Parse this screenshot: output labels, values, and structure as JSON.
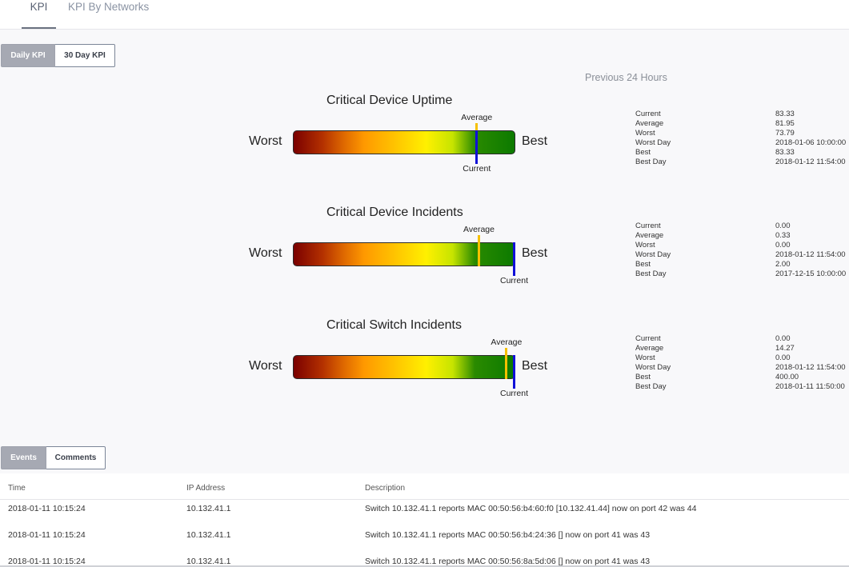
{
  "tabs": [
    {
      "label": "KPI",
      "active": true
    },
    {
      "label": "KPI By Networks",
      "active": false
    }
  ],
  "kpi_toggle": {
    "daily_label": "Daily KPI",
    "thirty_label": "30 Day KPI",
    "active": "daily"
  },
  "period_label": "Previous 24 Hours",
  "colors": {
    "average_marker": "#f5c000",
    "current_marker": "#1010d8",
    "gradient_worst": "#7a0000",
    "gradient_best": "#0c7a00"
  },
  "scale_labels": {
    "worst": "Worst",
    "best": "Best",
    "average": "Average",
    "current": "Current"
  },
  "kpis": [
    {
      "title": "Critical Device Uptime",
      "average_fraction": 0.83,
      "current_fraction": 0.83,
      "stats": [
        {
          "label": "Current",
          "value": "83.33"
        },
        {
          "label": "Average",
          "value": "81.95"
        },
        {
          "label": "Worst",
          "value": "73.79"
        },
        {
          "label": "Worst Day",
          "value": "2018-01-06 10:00:00"
        },
        {
          "label": "Best",
          "value": "83.33"
        },
        {
          "label": "Best Day",
          "value": "2018-01-12 11:54:00"
        }
      ]
    },
    {
      "title": "Critical Device Incidents",
      "average_fraction": 0.84,
      "current_fraction": 1.0,
      "stats": [
        {
          "label": "Current",
          "value": "0.00"
        },
        {
          "label": "Average",
          "value": "0.33"
        },
        {
          "label": "Worst",
          "value": "0.00"
        },
        {
          "label": "Worst Day",
          "value": "2018-01-12 11:54:00"
        },
        {
          "label": "Best",
          "value": "2.00"
        },
        {
          "label": "Best Day",
          "value": "2017-12-15 10:00:00"
        }
      ]
    },
    {
      "title": "Critical Switch Incidents",
      "average_fraction": 0.965,
      "current_fraction": 1.0,
      "stats": [
        {
          "label": "Current",
          "value": "0.00"
        },
        {
          "label": "Average",
          "value": "14.27"
        },
        {
          "label": "Worst",
          "value": "0.00"
        },
        {
          "label": "Worst Day",
          "value": "2018-01-12 11:54:00"
        },
        {
          "label": "Best",
          "value": "400.00"
        },
        {
          "label": "Best Day",
          "value": "2018-01-11 11:50:00"
        }
      ]
    }
  ],
  "events_toggle": {
    "events_label": "Events",
    "comments_label": "Comments",
    "active": "events"
  },
  "events_table": {
    "columns": [
      "Time",
      "IP Address",
      "Description"
    ],
    "rows": [
      {
        "time": "2018-01-11 10:15:24",
        "ip": "10.132.41.1",
        "description": "Switch 10.132.41.1 reports MAC 00:50:56:b4:60:f0 [10.132.41.44] now on port 42 was 44"
      },
      {
        "time": "2018-01-11 10:15:24",
        "ip": "10.132.41.1",
        "description": "Switch 10.132.41.1 reports MAC 00:50:56:b4:24:36 [] now on port 41 was 43"
      },
      {
        "time": "2018-01-11 10:15:24",
        "ip": "10.132.41.1",
        "description": "Switch 10.132.41.1 reports MAC 00:50:56:8a:5d:06 [] now on port 41 was 43"
      }
    ]
  }
}
